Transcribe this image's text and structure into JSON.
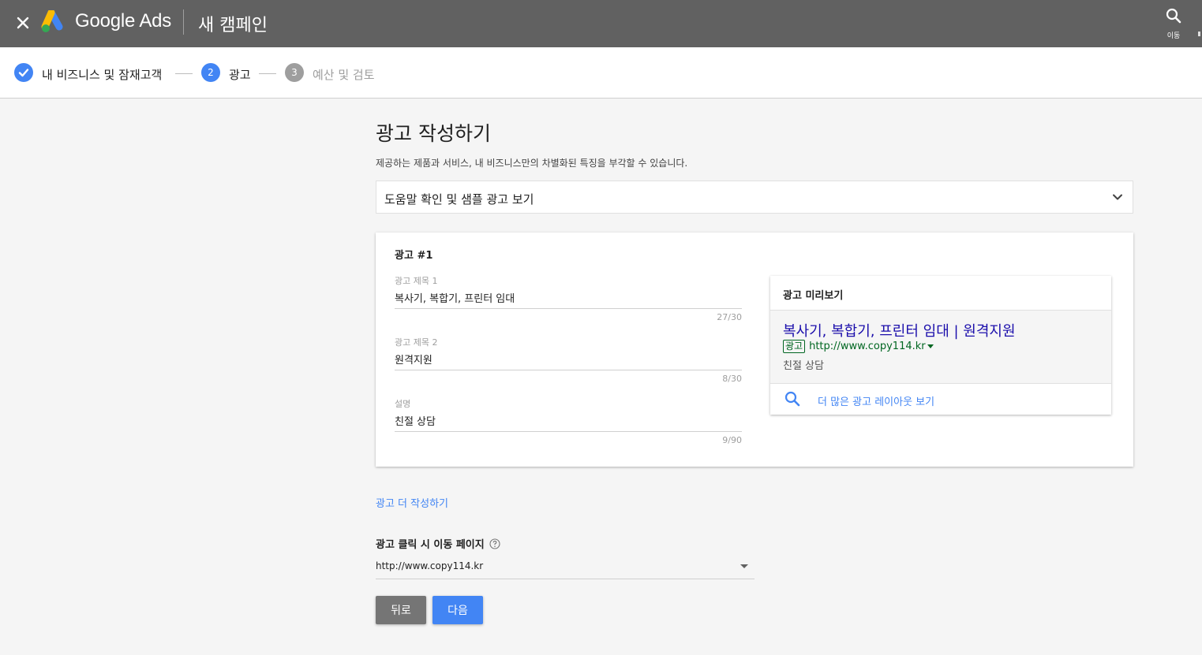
{
  "header": {
    "brand": "Google Ads",
    "campaign_title": "새 캠페인",
    "search_label": "이동"
  },
  "stepper": {
    "steps": [
      {
        "number": "1",
        "label": "내 비즈니스 및 잠재고객",
        "state": "complete"
      },
      {
        "number": "2",
        "label": "광고",
        "state": "active"
      },
      {
        "number": "3",
        "label": "예산 및 검토",
        "state": "upcoming"
      }
    ]
  },
  "main": {
    "heading": "광고 작성하기",
    "description": "제공하는 제품과 서비스, 내 비즈니스만의 차별화된 특징을 부각할 수 있습니다.",
    "help_accordion": "도움말 확인 및 샘플 광고 보기"
  },
  "ad_card": {
    "title": "광고 #1",
    "fields": [
      {
        "label": "광고 제목 1",
        "value": "복사기, 복합기, 프린터 임대",
        "count": "27/30"
      },
      {
        "label": "광고 제목 2",
        "value": "원격지원",
        "count": "8/30"
      },
      {
        "label": "설명",
        "value": "친절 상담",
        "count": "9/90"
      }
    ]
  },
  "preview": {
    "title": "광고 미리보기",
    "headline": "복사기, 복합기, 프린터 임대 | 원격지원",
    "badge": "광고",
    "url": "http://www.copy114.kr",
    "description": "친절 상담",
    "more_layouts": "더 많은 광고 레이아웃 보기"
  },
  "more_ads_link": "광고 더 작성하기",
  "landing": {
    "label": "광고 클릭 시 이동 페이지",
    "value": "http://www.copy114.kr"
  },
  "buttons": {
    "back": "뒤로",
    "next": "다음"
  },
  "colors": {
    "topbar": "#616161",
    "accent": "#4285f4",
    "ad_headline": "#1a0dab",
    "ad_url": "#006621"
  }
}
